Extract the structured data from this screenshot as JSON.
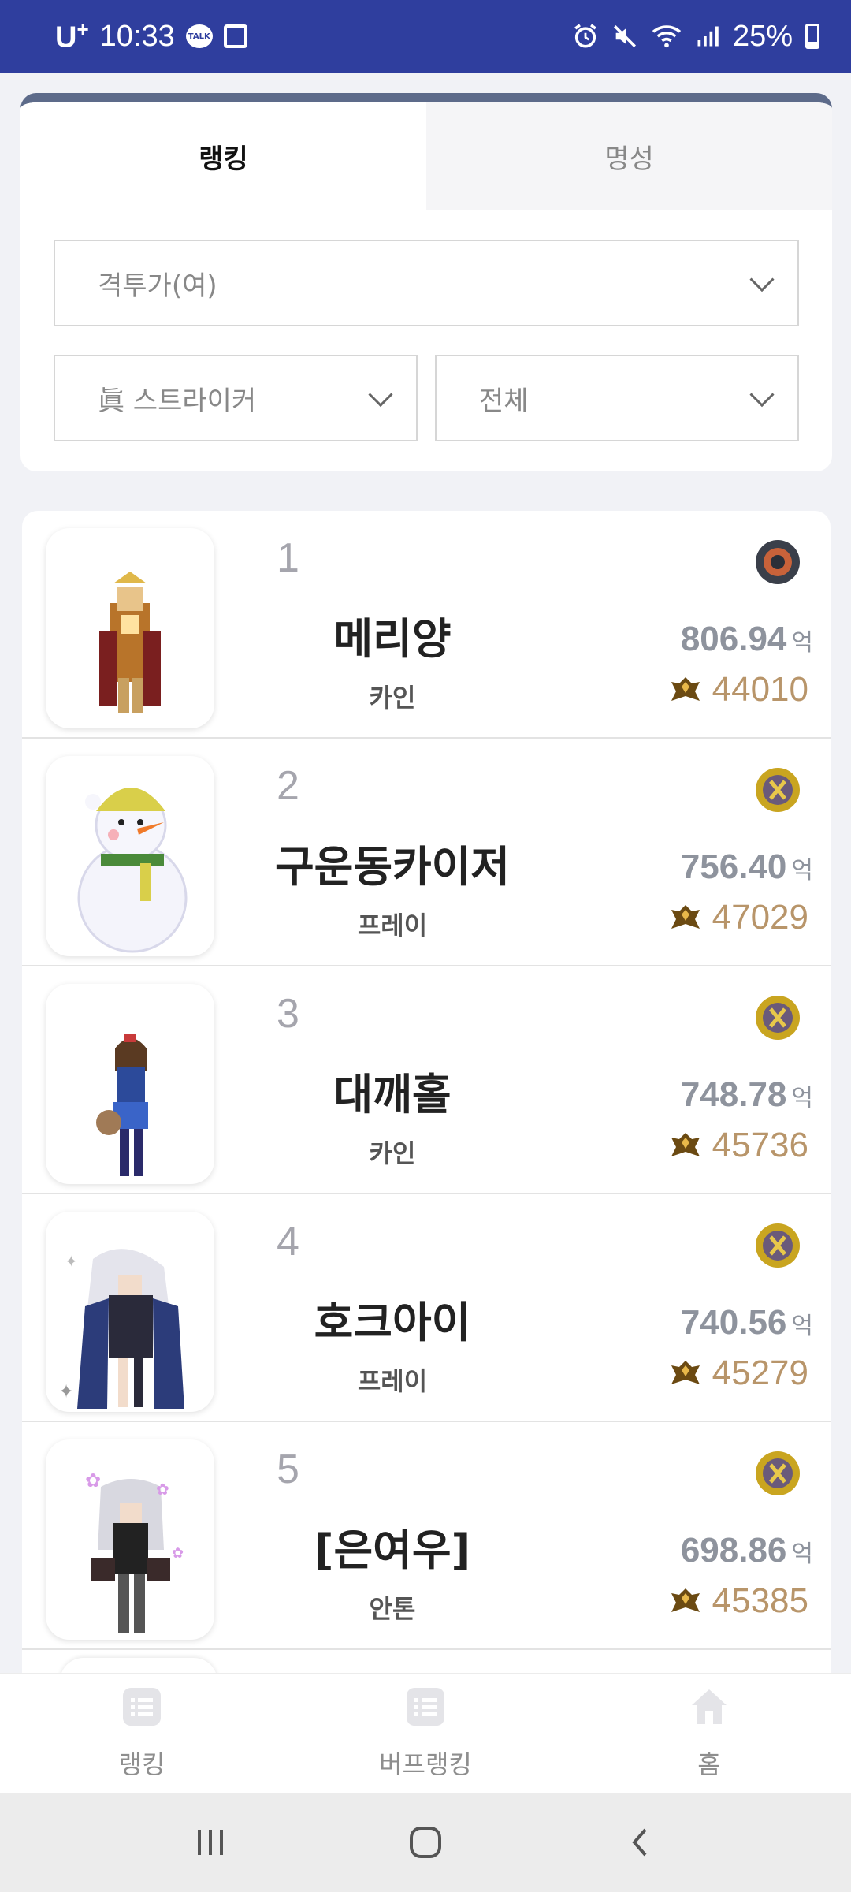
{
  "status_bar": {
    "carrier": "U",
    "carrier_sup": "+",
    "time": "10:33",
    "talk_badge": "TALK",
    "battery": "25%"
  },
  "tabs": [
    {
      "label": "랭킹",
      "active": true
    },
    {
      "label": "명성",
      "active": false
    }
  ],
  "filters": {
    "class_select": "격투가(여)",
    "subclass_select": "眞 스트라이커",
    "scope_select": "전체"
  },
  "rankings": [
    {
      "rank": "1",
      "name": "메리양",
      "server": "카인",
      "damage": "806.94",
      "unit": "억",
      "fame": "44010",
      "server_icon": "server-badge-dark"
    },
    {
      "rank": "2",
      "name": "구운동카이저",
      "server": "프레이",
      "damage": "756.40",
      "unit": "억",
      "fame": "47029",
      "server_icon": "server-badge-gold"
    },
    {
      "rank": "3",
      "name": "대깨홀",
      "server": "카인",
      "damage": "748.78",
      "unit": "억",
      "fame": "45736",
      "server_icon": "server-badge-gold"
    },
    {
      "rank": "4",
      "name": "호크아이",
      "server": "프레이",
      "damage": "740.56",
      "unit": "억",
      "fame": "45279",
      "server_icon": "server-badge-gold"
    },
    {
      "rank": "5",
      "name": "[은여우]",
      "server": "안톤",
      "damage": "698.86",
      "unit": "억",
      "fame": "45385",
      "server_icon": "server-badge-gold"
    }
  ],
  "bottom_nav": [
    {
      "label": "랭킹",
      "icon": "list-icon"
    },
    {
      "label": "버프랭킹",
      "icon": "list-icon"
    },
    {
      "label": "홈",
      "icon": "home-icon"
    }
  ],
  "colors": {
    "status_bar": "#2f3e9e",
    "fame": "#b8956a",
    "damage": "#8e939d",
    "card_top_border": "#5d6b8a"
  }
}
